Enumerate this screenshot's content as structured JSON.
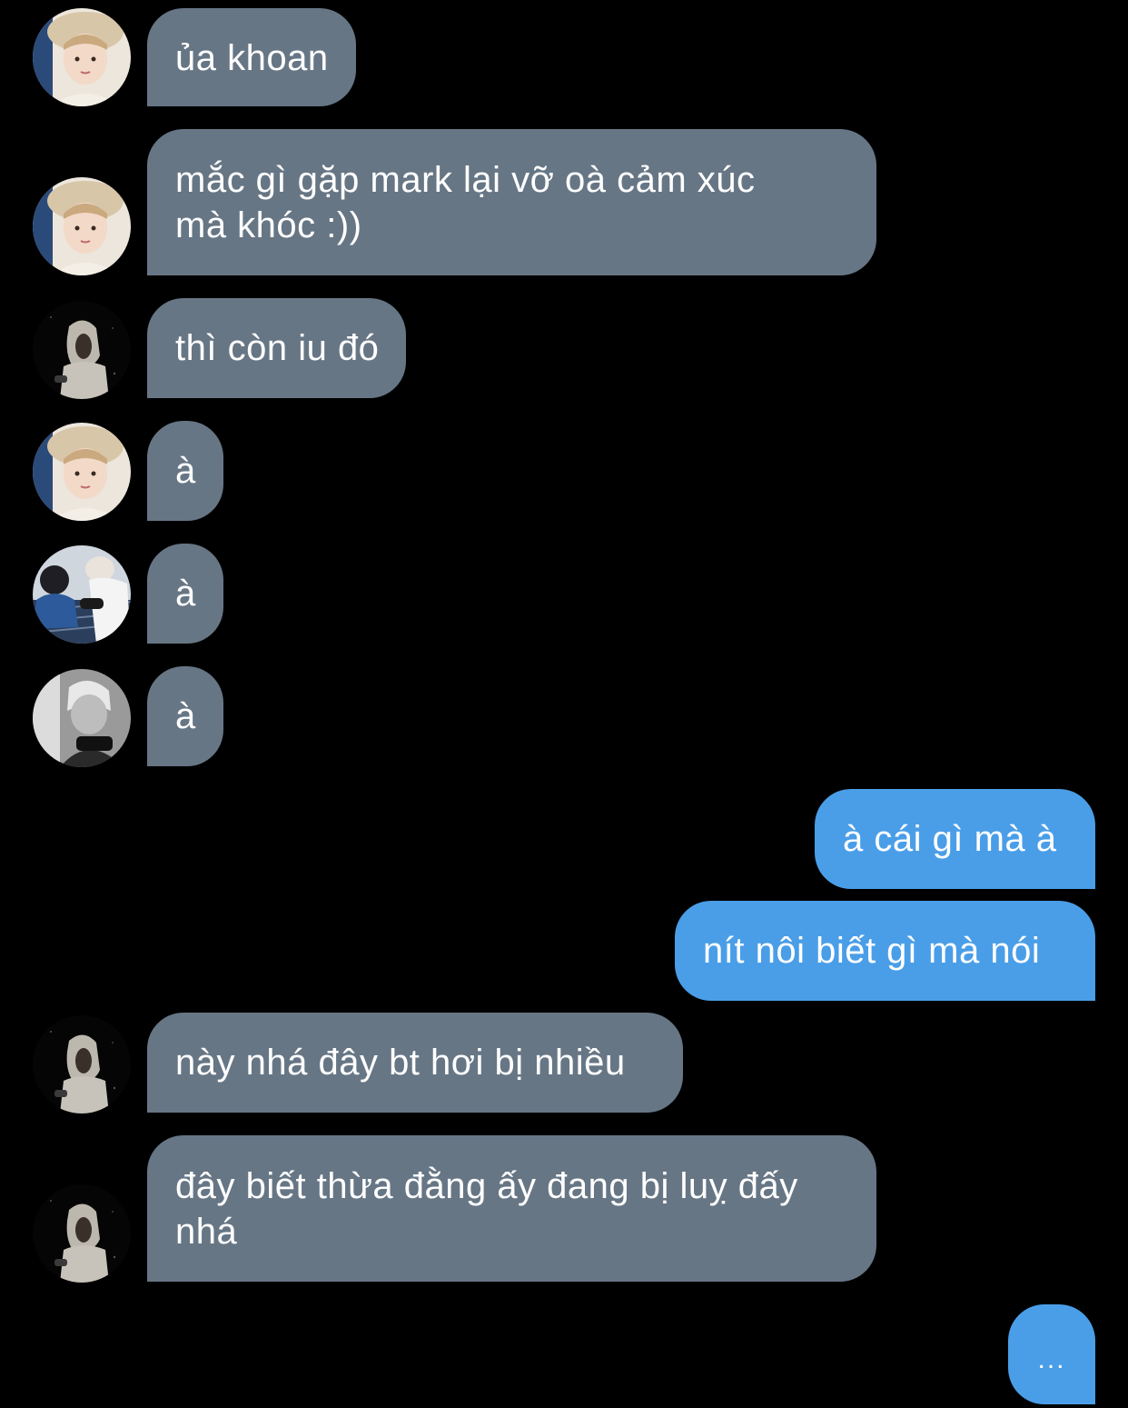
{
  "messages": [
    {
      "side": "in",
      "avatar": "avatar-beige-hat",
      "text": "ủa khoan"
    },
    {
      "side": "in",
      "avatar": "avatar-beige-hat",
      "text": "mắc gì gặp mark lại vỡ oà cảm xúc mà khóc :))"
    },
    {
      "side": "in",
      "avatar": "avatar-hoodie-dark",
      "text": "thì còn iu đó"
    },
    {
      "side": "in",
      "avatar": "avatar-beige-hat",
      "text": "à"
    },
    {
      "side": "in",
      "avatar": "avatar-blue-outdoor",
      "text": "à"
    },
    {
      "side": "in",
      "avatar": "avatar-grayscale",
      "text": "à"
    },
    {
      "side": "out",
      "text": "à cái gì mà à"
    },
    {
      "side": "out",
      "text": "nít nôi biết gì mà nói"
    },
    {
      "side": "in",
      "avatar": "avatar-hoodie-dark",
      "text": "này nhá đây bt hơi bị nhiều"
    },
    {
      "side": "in",
      "avatar": "avatar-hoodie-dark",
      "text": "đây biết thừa đằng ấy đang bị luỵ đấy nhá"
    },
    {
      "side": "out",
      "text": "..."
    }
  ],
  "colors": {
    "background": "#000000",
    "incoming_bubble": "#677685",
    "outgoing_bubble": "#4a9ee8",
    "text": "#ffffff"
  }
}
